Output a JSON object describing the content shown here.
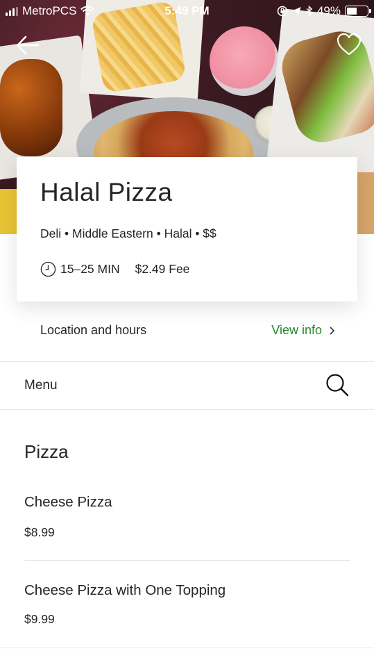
{
  "status_bar": {
    "carrier": "MetroPCS",
    "time": "5:49 PM",
    "battery": "49%",
    "battery_level": 0.49
  },
  "nav": {
    "back_icon": "arrow-left-icon",
    "favorite_icon": "heart-outline-icon"
  },
  "restaurant": {
    "name": "Halal Pizza",
    "tags": "Deli • Middle Eastern • Halal • $$",
    "eta": "15–25 MIN",
    "fee": "$2.49 Fee"
  },
  "location": {
    "label": "Location and hours",
    "link": "View info"
  },
  "menu": {
    "label": "Menu",
    "search_icon": "search-icon",
    "section": "Pizza",
    "items": [
      {
        "name": "Cheese Pizza",
        "price": "$8.99"
      },
      {
        "name": "Cheese Pizza with One Topping",
        "price": "$9.99"
      }
    ]
  },
  "colors": {
    "accent": "#25892f",
    "text": "#262626",
    "divider": "#e5e5e5"
  }
}
